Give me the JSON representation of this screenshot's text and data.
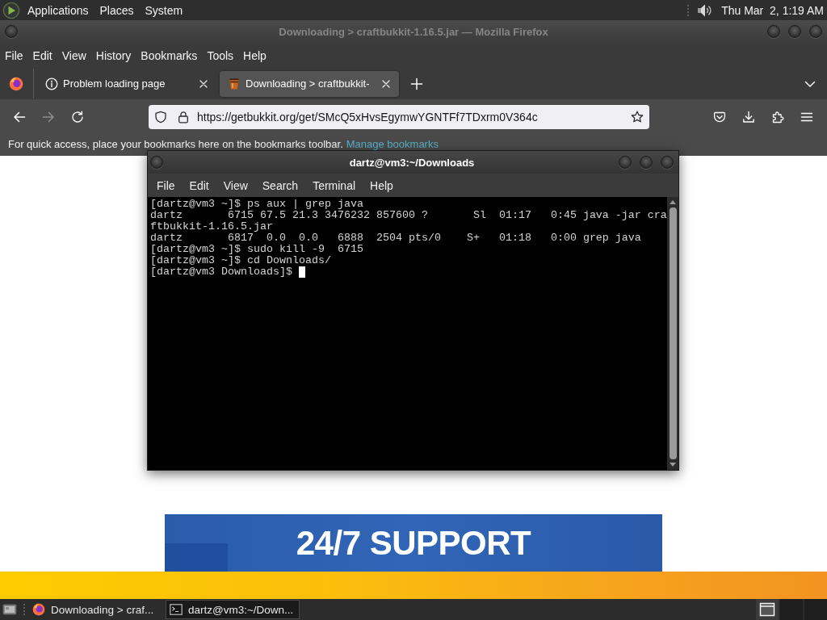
{
  "top_panel": {
    "menus": [
      "Applications",
      "Places",
      "System"
    ],
    "clock": "Thu Mar  2, 1:19 AM"
  },
  "firefox": {
    "title": "Downloading > craftbukkit-1.16.5.jar — Mozilla Firefox",
    "focused": false,
    "menu": [
      "File",
      "Edit",
      "View",
      "History",
      "Bookmarks",
      "Tools",
      "Help"
    ],
    "tabs": [
      {
        "label": "Problem loading page",
        "kind": "info",
        "selected": false
      },
      {
        "label": "Downloading > craftbukkit-",
        "kind": "site",
        "selected": true
      }
    ],
    "nav_buttons": [
      {
        "kind": "back",
        "disabled": false
      },
      {
        "kind": "forward",
        "disabled": true
      },
      {
        "kind": "reload",
        "disabled": false
      }
    ],
    "url": "https://getbukkit.org/get/SMcQ5xHvsEgymwYGNTFf7TDxrm0V364c",
    "bookmarks_bar": {
      "message": "For quick access, place your bookmarks here on the bookmarks toolbar.",
      "link": "Manage bookmarks"
    },
    "page": {
      "banner": "24/7 SUPPORT"
    }
  },
  "terminal": {
    "title": "dartz@vm3:~/Downloads",
    "focused": true,
    "menu": [
      "File",
      "Edit",
      "View",
      "Search",
      "Terminal",
      "Help"
    ],
    "lines": [
      "[dartz@vm3 ~]$ ps aux | grep java",
      "dartz       6715 67.5 21.3 3476232 857600 ?       Sl  01:17   0:45 java -jar cra",
      "ftbukkit-1.16.5.jar",
      "dartz       6817  0.0  0.0   6888  2504 pts/0    S+   01:18   0:00 grep java",
      "[dartz@vm3 ~]$ sudo kill -9  6715",
      "[dartz@vm3 ~]$ cd Downloads/",
      "[dartz@vm3 Downloads]$ "
    ],
    "cursor": true
  },
  "taskbar": {
    "tasks": [
      {
        "label": "Downloading > craf...",
        "kind": "browser",
        "selected": false
      },
      {
        "label": "dartz@vm3:~/Down...",
        "kind": "terminal",
        "selected": true
      }
    ]
  }
}
